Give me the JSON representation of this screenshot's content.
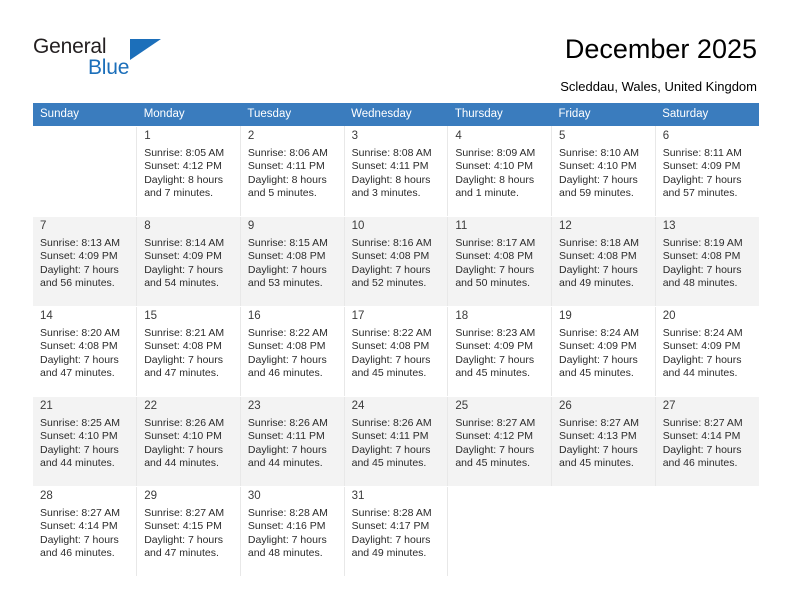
{
  "brand": {
    "word_general": "General",
    "word_blue": "Blue",
    "accent_color": "#1c6fba",
    "logo_icon": "triangle-logo-icon"
  },
  "header": {
    "title": "December 2025",
    "location": "Scleddau, Wales, United Kingdom",
    "header_bg_color": "#3a7cbe"
  },
  "calendar": {
    "weekday_headers": [
      "Sunday",
      "Monday",
      "Tuesday",
      "Wednesday",
      "Thursday",
      "Friday",
      "Saturday"
    ],
    "weeks": [
      [
        {
          "day": "",
          "info": ""
        },
        {
          "day": "1",
          "info": "Sunrise: 8:05 AM\nSunset: 4:12 PM\nDaylight: 8 hours\nand 7 minutes."
        },
        {
          "day": "2",
          "info": "Sunrise: 8:06 AM\nSunset: 4:11 PM\nDaylight: 8 hours\nand 5 minutes."
        },
        {
          "day": "3",
          "info": "Sunrise: 8:08 AM\nSunset: 4:11 PM\nDaylight: 8 hours\nand 3 minutes."
        },
        {
          "day": "4",
          "info": "Sunrise: 8:09 AM\nSunset: 4:10 PM\nDaylight: 8 hours\nand 1 minute."
        },
        {
          "day": "5",
          "info": "Sunrise: 8:10 AM\nSunset: 4:10 PM\nDaylight: 7 hours\nand 59 minutes."
        },
        {
          "day": "6",
          "info": "Sunrise: 8:11 AM\nSunset: 4:09 PM\nDaylight: 7 hours\nand 57 minutes."
        }
      ],
      [
        {
          "day": "7",
          "info": "Sunrise: 8:13 AM\nSunset: 4:09 PM\nDaylight: 7 hours\nand 56 minutes."
        },
        {
          "day": "8",
          "info": "Sunrise: 8:14 AM\nSunset: 4:09 PM\nDaylight: 7 hours\nand 54 minutes."
        },
        {
          "day": "9",
          "info": "Sunrise: 8:15 AM\nSunset: 4:08 PM\nDaylight: 7 hours\nand 53 minutes."
        },
        {
          "day": "10",
          "info": "Sunrise: 8:16 AM\nSunset: 4:08 PM\nDaylight: 7 hours\nand 52 minutes."
        },
        {
          "day": "11",
          "info": "Sunrise: 8:17 AM\nSunset: 4:08 PM\nDaylight: 7 hours\nand 50 minutes."
        },
        {
          "day": "12",
          "info": "Sunrise: 8:18 AM\nSunset: 4:08 PM\nDaylight: 7 hours\nand 49 minutes."
        },
        {
          "day": "13",
          "info": "Sunrise: 8:19 AM\nSunset: 4:08 PM\nDaylight: 7 hours\nand 48 minutes."
        }
      ],
      [
        {
          "day": "14",
          "info": "Sunrise: 8:20 AM\nSunset: 4:08 PM\nDaylight: 7 hours\nand 47 minutes."
        },
        {
          "day": "15",
          "info": "Sunrise: 8:21 AM\nSunset: 4:08 PM\nDaylight: 7 hours\nand 47 minutes."
        },
        {
          "day": "16",
          "info": "Sunrise: 8:22 AM\nSunset: 4:08 PM\nDaylight: 7 hours\nand 46 minutes."
        },
        {
          "day": "17",
          "info": "Sunrise: 8:22 AM\nSunset: 4:08 PM\nDaylight: 7 hours\nand 45 minutes."
        },
        {
          "day": "18",
          "info": "Sunrise: 8:23 AM\nSunset: 4:09 PM\nDaylight: 7 hours\nand 45 minutes."
        },
        {
          "day": "19",
          "info": "Sunrise: 8:24 AM\nSunset: 4:09 PM\nDaylight: 7 hours\nand 45 minutes."
        },
        {
          "day": "20",
          "info": "Sunrise: 8:24 AM\nSunset: 4:09 PM\nDaylight: 7 hours\nand 44 minutes."
        }
      ],
      [
        {
          "day": "21",
          "info": "Sunrise: 8:25 AM\nSunset: 4:10 PM\nDaylight: 7 hours\nand 44 minutes."
        },
        {
          "day": "22",
          "info": "Sunrise: 8:26 AM\nSunset: 4:10 PM\nDaylight: 7 hours\nand 44 minutes."
        },
        {
          "day": "23",
          "info": "Sunrise: 8:26 AM\nSunset: 4:11 PM\nDaylight: 7 hours\nand 44 minutes."
        },
        {
          "day": "24",
          "info": "Sunrise: 8:26 AM\nSunset: 4:11 PM\nDaylight: 7 hours\nand 45 minutes."
        },
        {
          "day": "25",
          "info": "Sunrise: 8:27 AM\nSunset: 4:12 PM\nDaylight: 7 hours\nand 45 minutes."
        },
        {
          "day": "26",
          "info": "Sunrise: 8:27 AM\nSunset: 4:13 PM\nDaylight: 7 hours\nand 45 minutes."
        },
        {
          "day": "27",
          "info": "Sunrise: 8:27 AM\nSunset: 4:14 PM\nDaylight: 7 hours\nand 46 minutes."
        }
      ],
      [
        {
          "day": "28",
          "info": "Sunrise: 8:27 AM\nSunset: 4:14 PM\nDaylight: 7 hours\nand 46 minutes."
        },
        {
          "day": "29",
          "info": "Sunrise: 8:27 AM\nSunset: 4:15 PM\nDaylight: 7 hours\nand 47 minutes."
        },
        {
          "day": "30",
          "info": "Sunrise: 8:28 AM\nSunset: 4:16 PM\nDaylight: 7 hours\nand 48 minutes."
        },
        {
          "day": "31",
          "info": "Sunrise: 8:28 AM\nSunset: 4:17 PM\nDaylight: 7 hours\nand 49 minutes."
        },
        {
          "day": "",
          "info": ""
        },
        {
          "day": "",
          "info": ""
        },
        {
          "day": "",
          "info": ""
        }
      ]
    ]
  }
}
